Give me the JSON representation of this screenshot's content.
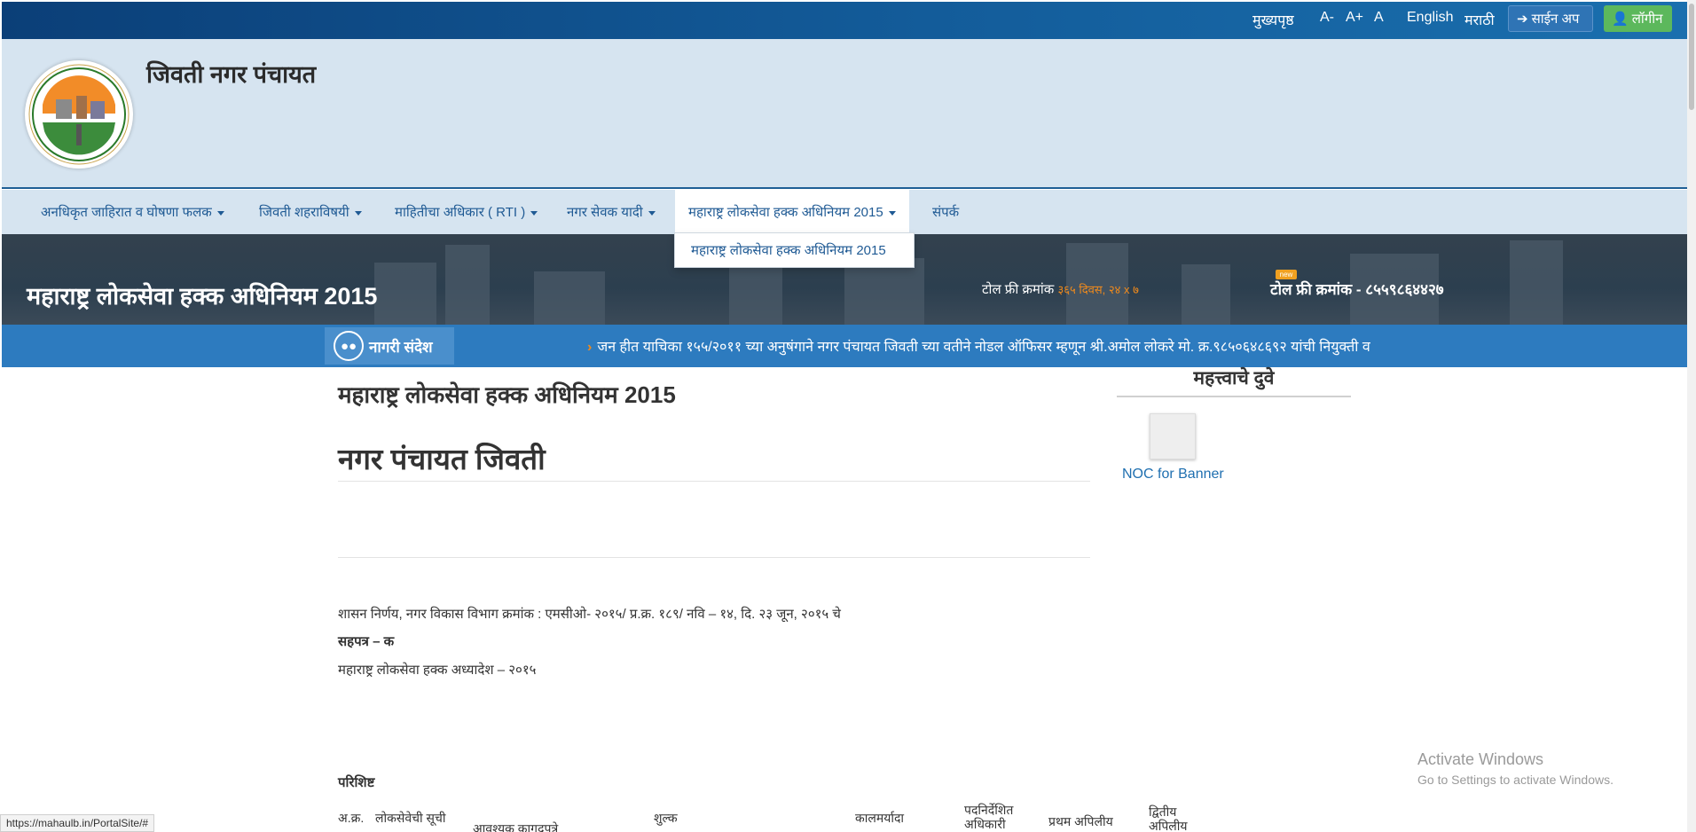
{
  "topbar": {
    "home": "मुख्यपृष्ठ",
    "font_decrease": "A-",
    "font_increase": "A+",
    "font_reset": "A",
    "lang_english": "English",
    "lang_marathi": "मराठी",
    "signup": "साईन अप",
    "login": "लॉगीन"
  },
  "header": {
    "site_title": "जिवती नगर पंचायत"
  },
  "nav": {
    "items": [
      {
        "label": "अनधिकृत जाहिरात व घोषणा फलक"
      },
      {
        "label": "जिवती शहराविषयी"
      },
      {
        "label": "माहितीचा अधिकार ( RTI )"
      },
      {
        "label": "नगर सेवक यादी"
      },
      {
        "label": "महाराष्ट्र लोकसेवा हक्क अधिनियम 2015"
      },
      {
        "label": "संपर्क"
      }
    ],
    "dropdown_item": "महाराष्ट्र लोकसेवा हक्क अधिनियम 2015"
  },
  "banner": {
    "title": "महाराष्ट्र लोकसेवा हक्क अधिनियम 2015",
    "tollfree_label": "टोल फ्री क्रमांक",
    "tollfree_hours": "३६५ दिवस, २४ x ७",
    "new_badge": "new",
    "tollfree_number": "टोल फ्री क्रमांक - ८५५९८६४४२७"
  },
  "notice": {
    "label": "नागरी संदेश",
    "text": "जन हीत याचिका १५५/२०११ च्या अनुषंगाने नगर पंचायत जिवती च्या वतीने नोडल ऑफिसर म्हणून श्री.अमोल लोकरे मो. क्र.९८५०६४८६९२ यांची नियुक्ती व"
  },
  "content": {
    "heading": "महाराष्ट्र लोकसेवा हक्क अधिनियम 2015",
    "subheading": "नगर पंचायत जिवती",
    "para1": "शासन निर्णय, नगर विकास विभाग क्रमांक : एमसीओ- २०१५/ प्र.क्र. १८९/ नवि – १४, दि. २३ जून, २०१५ चे",
    "para2": "सहपत्र – क",
    "para3": "महाराष्ट्र लोकसेवा हक्क अध्यादेश – २०१५",
    "appendix": "परिशिष्ट",
    "table_headers": [
      "अ.क्र.",
      "लोकसेवेची सूची",
      "आवश्यक कागदपत्रे",
      "शुल्क",
      "कालमर्यादा",
      "पदनिर्देशित अधिकारी",
      "प्रथम अपिलीय",
      "द्वितीय अपिलीय"
    ]
  },
  "sidebar": {
    "title": "महत्त्वाचे दुवे",
    "link": "NOC for Banner"
  },
  "system": {
    "watermark_title": "Activate Windows",
    "watermark_sub": "Go to Settings to activate Windows.",
    "status_url": "https://mahaulb.in/PortalSite/#"
  }
}
